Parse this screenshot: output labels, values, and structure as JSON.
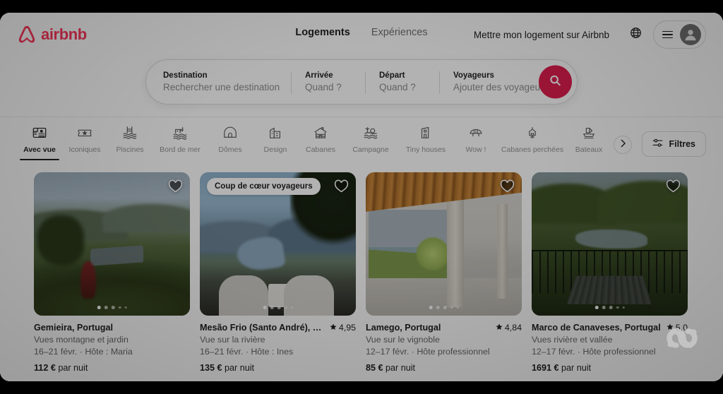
{
  "header": {
    "logo_text": "airbnb",
    "nav": [
      {
        "label": "Logements",
        "active": true
      },
      {
        "label": "Expériences",
        "active": false
      }
    ],
    "host_link": "Mettre mon logement sur Airbnb",
    "brand_color": "#FF385C",
    "search_button_color": "#E01E4F"
  },
  "search": {
    "destination_label": "Destination",
    "destination_placeholder": "Rechercher une destination",
    "arrival_label": "Arrivée",
    "arrival_value": "Quand ?",
    "departure_label": "Départ",
    "departure_value": "Quand ?",
    "guests_label": "Voyageurs",
    "guests_placeholder": "Ajouter des voyageurs"
  },
  "categories": [
    {
      "label": "Avec vue",
      "icon": "view-icon",
      "active": true
    },
    {
      "label": "Iconiques",
      "icon": "ticket-star-icon",
      "active": false
    },
    {
      "label": "Piscines",
      "icon": "pool-icon",
      "active": false
    },
    {
      "label": "Bord de mer",
      "icon": "seaside-icon",
      "active": false
    },
    {
      "label": "Dômes",
      "icon": "dome-icon",
      "active": false
    },
    {
      "label": "Design",
      "icon": "design-icon",
      "active": false
    },
    {
      "label": "Cabanes",
      "icon": "cabin-icon",
      "active": false
    },
    {
      "label": "Campagne",
      "icon": "countryside-icon",
      "active": false
    },
    {
      "label": "Tiny houses",
      "icon": "tiny-house-icon",
      "active": false
    },
    {
      "label": "Wow !",
      "icon": "wow-icon",
      "active": false
    },
    {
      "label": "Cabanes perchées",
      "icon": "treehouse-icon",
      "active": false
    },
    {
      "label": "Bateaux",
      "icon": "boat-icon",
      "active": false
    }
  ],
  "toolbar": {
    "next_arrow": "chevron-right-icon",
    "filters_label": "Filtres",
    "filters_icon": "sliders-icon"
  },
  "listings": [
    {
      "title": "Gemieira, Portugal",
      "subtitle": "Vues montagne et jardin",
      "dates": "16–21 févr. · Hôte : Maria",
      "price": "112 €",
      "price_unit": "par nuit",
      "rating": "",
      "badge": "",
      "favorited": true,
      "dots": 5,
      "active_dot": 0
    },
    {
      "title": "Mesão Frio (Santo André), Portugal",
      "subtitle": "Vue sur la rivière",
      "dates": "16–21 févr. · Hôte : Ines",
      "price": "135 €",
      "price_unit": "par nuit",
      "rating": "4,95",
      "badge": "Coup de cœur voyageurs",
      "favorited": false,
      "dots": 5,
      "active_dot": 0
    },
    {
      "title": "Lamego, Portugal",
      "subtitle": "Vue sur le vignoble",
      "dates": "12–17 févr. · Hôte professionnel",
      "price": "85 €",
      "price_unit": "par nuit",
      "rating": "4,84",
      "badge": "",
      "favorited": true,
      "dots": 5,
      "active_dot": 0
    },
    {
      "title": "Marco de Canaveses, Portugal",
      "subtitle": "Vues rivière et vallée",
      "dates": "12–17 févr. · Hôte professionnel",
      "price": "1691 €",
      "price_unit": "par nuit",
      "rating": "5,0",
      "badge": "",
      "favorited": true,
      "dots": 5,
      "active_dot": 0
    }
  ]
}
